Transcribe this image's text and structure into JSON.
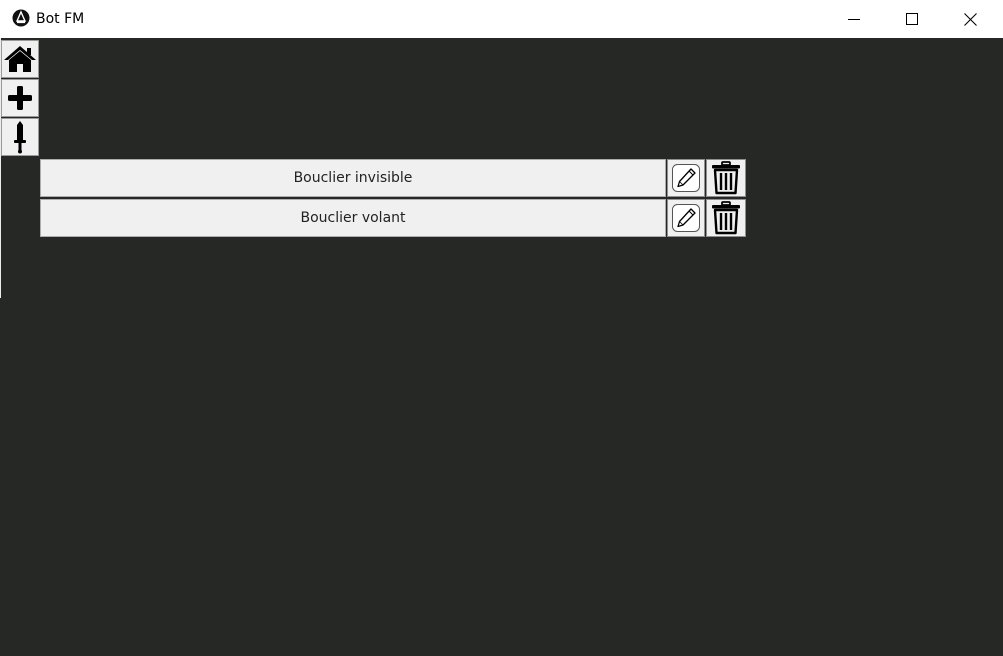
{
  "window": {
    "title": "Bot FM",
    "app_icon": "bot-logo-icon",
    "controls": [
      "minimize-icon",
      "maximize-icon",
      "close-icon"
    ]
  },
  "sidebar": {
    "items": [
      {
        "name": "home",
        "icon": "home-icon"
      },
      {
        "name": "add",
        "icon": "plus-icon"
      },
      {
        "name": "sword",
        "icon": "sword-icon"
      }
    ]
  },
  "list": {
    "items": [
      {
        "label": "Bouclier invisible",
        "edit_icon": "pencil-icon",
        "delete_icon": "trash-icon"
      },
      {
        "label": "Bouclier volant",
        "edit_icon": "pencil-icon",
        "delete_icon": "trash-icon"
      }
    ]
  },
  "colors": {
    "background": "#262826",
    "titlebar": "#ffffff",
    "button_face": "#f0f0f0",
    "text": "#222222"
  }
}
